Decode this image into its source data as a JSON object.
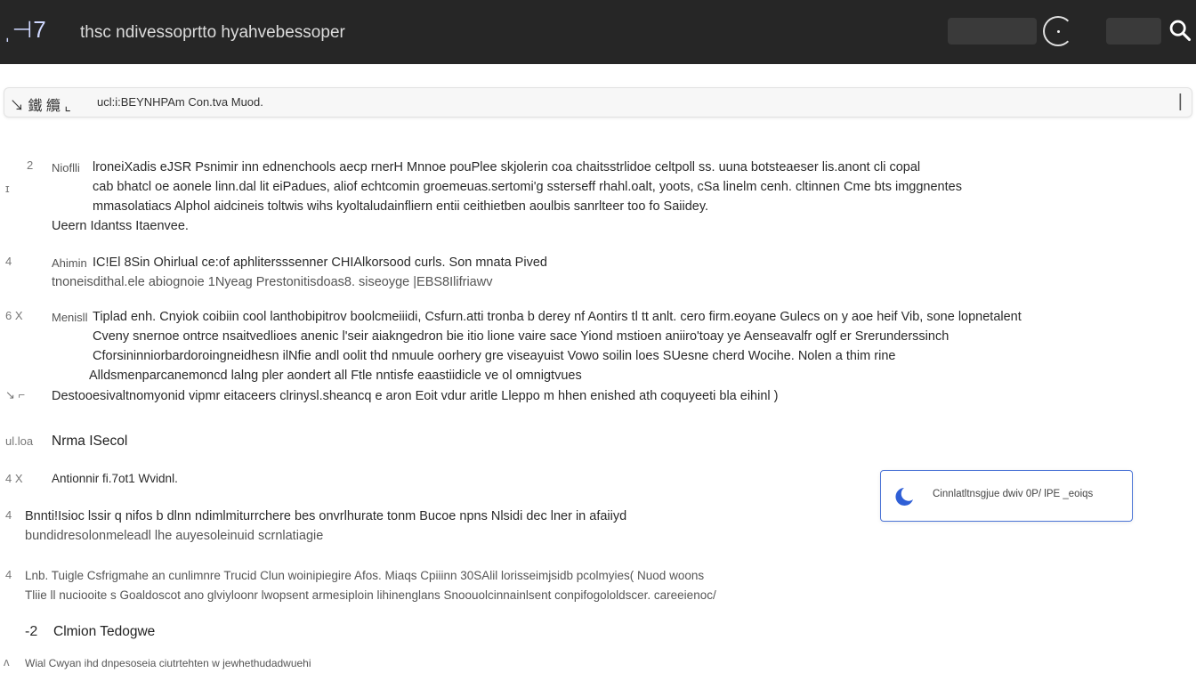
{
  "app": {
    "logo": "ˌ⊣7",
    "title": "thsc ndivessoprtto  hyahvebessoper"
  },
  "toolbar": {
    "icons_text": "↘ 鐵 纜 ⌞",
    "path": "ucl:i:BEYNHPAm Con.tva Muod.",
    "caret": "|"
  },
  "items": [
    {
      "marker": "2",
      "side": "Nioflli",
      "lines": [
        "lroneiXadis eJSR Psnimir inn ednenchools aecp rnerH Mnnoe pouPlee skjolerin coa chaitsstrlidoe  celtpoll ss. uuna botsteaeser lis.anont cli copal",
        "cab bhatcl oe aonele linn.dal lit eiPadues, aliof echtcomin groemeuas.sertomi'g ssterseff rhahl.oalt, yoots, cSa linelm cenh. cltinnen Cme bts imggnentes",
        "mmasolatiacs Alphol aidcineis toltwis wihs kyoltaludainfliern entii ceithietben aoulbis sanrlteer too fo Saiidey."
      ]
    },
    {
      "marker": "",
      "side": "",
      "lines": [
        "Ueern Idantss  Itaenvee."
      ]
    },
    {
      "marker": "4",
      "side": "Ahimin",
      "lines": [
        "IC!El 8Sin Ohirlual ce:of aphlitersssenner CHIAlkorsood curls. Son mnata Pived",
        "tnoneisdithal.ele abiognoie 1Nyeag Prestonitisdoas8. siseoyge |EBS8Ilifriawv"
      ]
    },
    {
      "marker": "6  X",
      "side": "Menisll",
      "lines": [
        "Tiplad enh. Cnyiok coibiin cool lanthobipitrov boolcmeiiidi, Csfurn.atti tronba b derey nf Aontirs tl tt anlt. cero firm.eoyane Gulecs on y aoe heif Vib, sone lopnetalent",
        "Cveny snernoe ontrce nsaitvedlioes anenic l'seir aiakngedron bie itio lione vaire sace Yiond mstioen aniiro'toay ye Aenseavalfr oglf er Srerunderssinch",
        "Cforsininniorbardoroingneidhesn ilNfie andl oolit thd nmuule oorhery gre viseayuist Vowo soilin loes SUesne cherd Wocihe.    Nolen a thim rine",
        "Alldsmenparcanemoncd lalng pler aondert all Ftle nntisfe eaastiidicle ve ol omnigtvues"
      ]
    },
    {
      "marker": "↘ ⌐",
      "side": "Destooesivaltnomyonid vipmr eitaceers clrinysl.sheancq e aron Eoit vdur aritle Lleppo m hhen enished ath coquyeeti bla eihinl )",
      "lines": []
    }
  ],
  "sections": [
    {
      "marker": "ul.loa",
      "label": "Nrma ISecol"
    },
    {
      "marker": "4   X",
      "label": "Antionnir fi.7ot1 Wvidnl."
    }
  ],
  "more": [
    {
      "marker": "4",
      "lines": [
        "Bnnti!Isioc lssir q nifos b dlnn ndimlmiturrchere bes onvrlhurate tonm Bucoe npns Nlsidi dec lner in afaiiyd",
        "bundidresolonmeleadl lhe auyesoleinuid scrnlatiagie"
      ]
    },
    {
      "marker": "4",
      "lines": [
        "Lnb. Tuigle Csfrigmahe an cunlimnre Trucid Clun woinipiegire Afos. Miaqs  Cpiiinn 30SAlil lorisseimjsidb pcolmyies( Nuod woons",
        "Tliie ll nuciooite s Goaldoscot ano glviyloonr lwopsent armesiploin lihinenglans Snoouolcinnainlsent conpifogololdscer. careeienoc/"
      ]
    }
  ],
  "footer": {
    "marker": "-2",
    "heading": "Clmion Tedogwe",
    "note_marker": "ʌ",
    "note": "Wial  Cwyan ihd dnpesoseia ciutrtehten w jewhethudadwuehi"
  },
  "popup": {
    "text": "Cinnlatltnsgjue dwiv 0P/ lPE _eoiqs"
  },
  "colors": {
    "topbar": "#262626",
    "accent": "#4b74d6"
  },
  "icons": {
    "search": "search-icon",
    "loading": "loading-spinner-icon",
    "popup": "moon-icon"
  }
}
